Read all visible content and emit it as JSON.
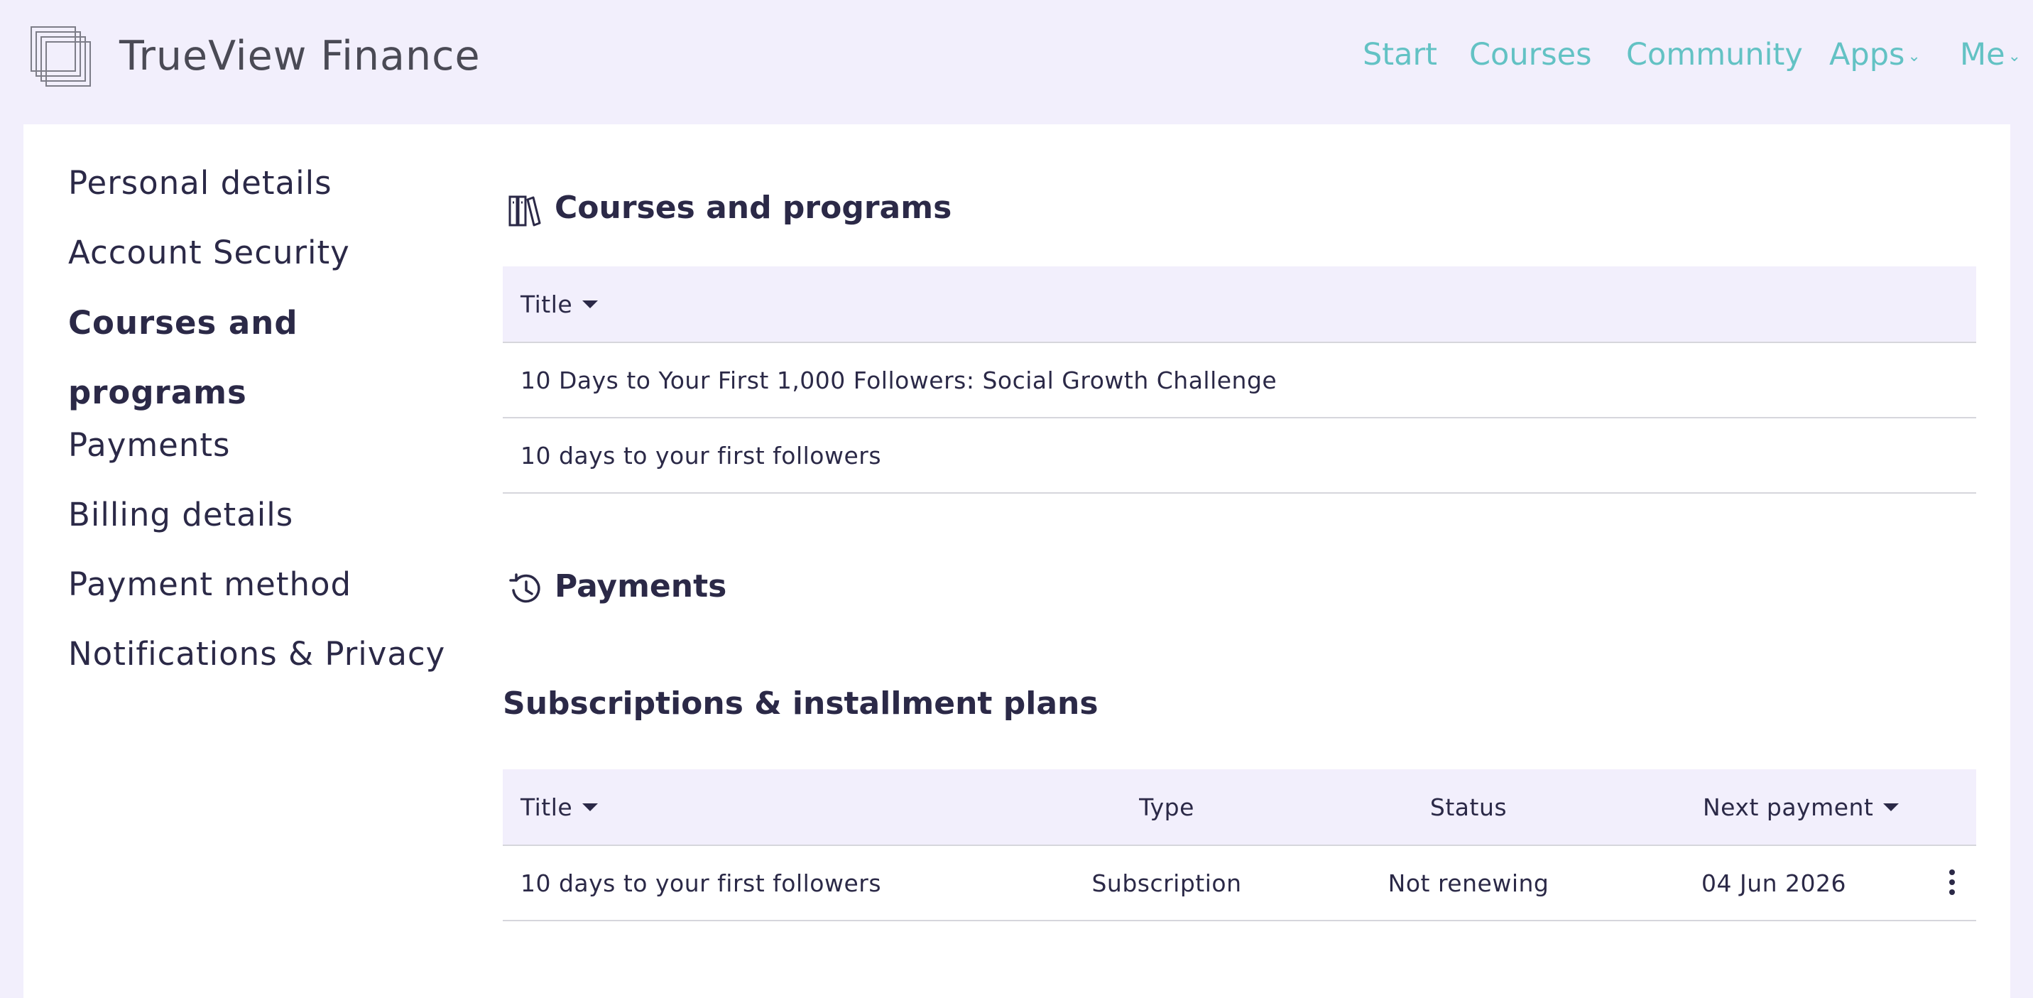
{
  "header": {
    "brand": "TrueView Finance",
    "nav": [
      {
        "label": "Start",
        "dropdown": false
      },
      {
        "label": "Courses",
        "dropdown": false
      },
      {
        "label": "Community",
        "dropdown": false
      },
      {
        "label": "Apps",
        "dropdown": true
      },
      {
        "label": "Me",
        "dropdown": true
      }
    ]
  },
  "sidebar": {
    "items": [
      {
        "label": "Personal details"
      },
      {
        "label": "Account Security"
      },
      {
        "label": "Courses and programs",
        "active": true
      },
      {
        "label": "Payments"
      },
      {
        "label": "Billing details"
      },
      {
        "label": "Payment method"
      },
      {
        "label": "Notifications & Privacy"
      }
    ]
  },
  "courses": {
    "title": "Courses and programs",
    "icon": "books-icon",
    "column": "Title",
    "rows": [
      "10 Days to Your First 1,000 Followers: Social Growth Challenge",
      "10 days to your first followers"
    ]
  },
  "payments": {
    "title": "Payments",
    "icon": "history-icon",
    "subtitle": "Subscriptions & installment plans",
    "columns": {
      "title": "Title",
      "type": "Type",
      "status": "Status",
      "next": "Next payment"
    },
    "rows": [
      {
        "title": "10 days to your first followers",
        "type": "Subscription",
        "status": "Not renewing",
        "next": "04 Jun 2026"
      }
    ]
  },
  "colors": {
    "accent": "#63c2c4",
    "background": "#f2effc",
    "text": "#2b2947"
  }
}
